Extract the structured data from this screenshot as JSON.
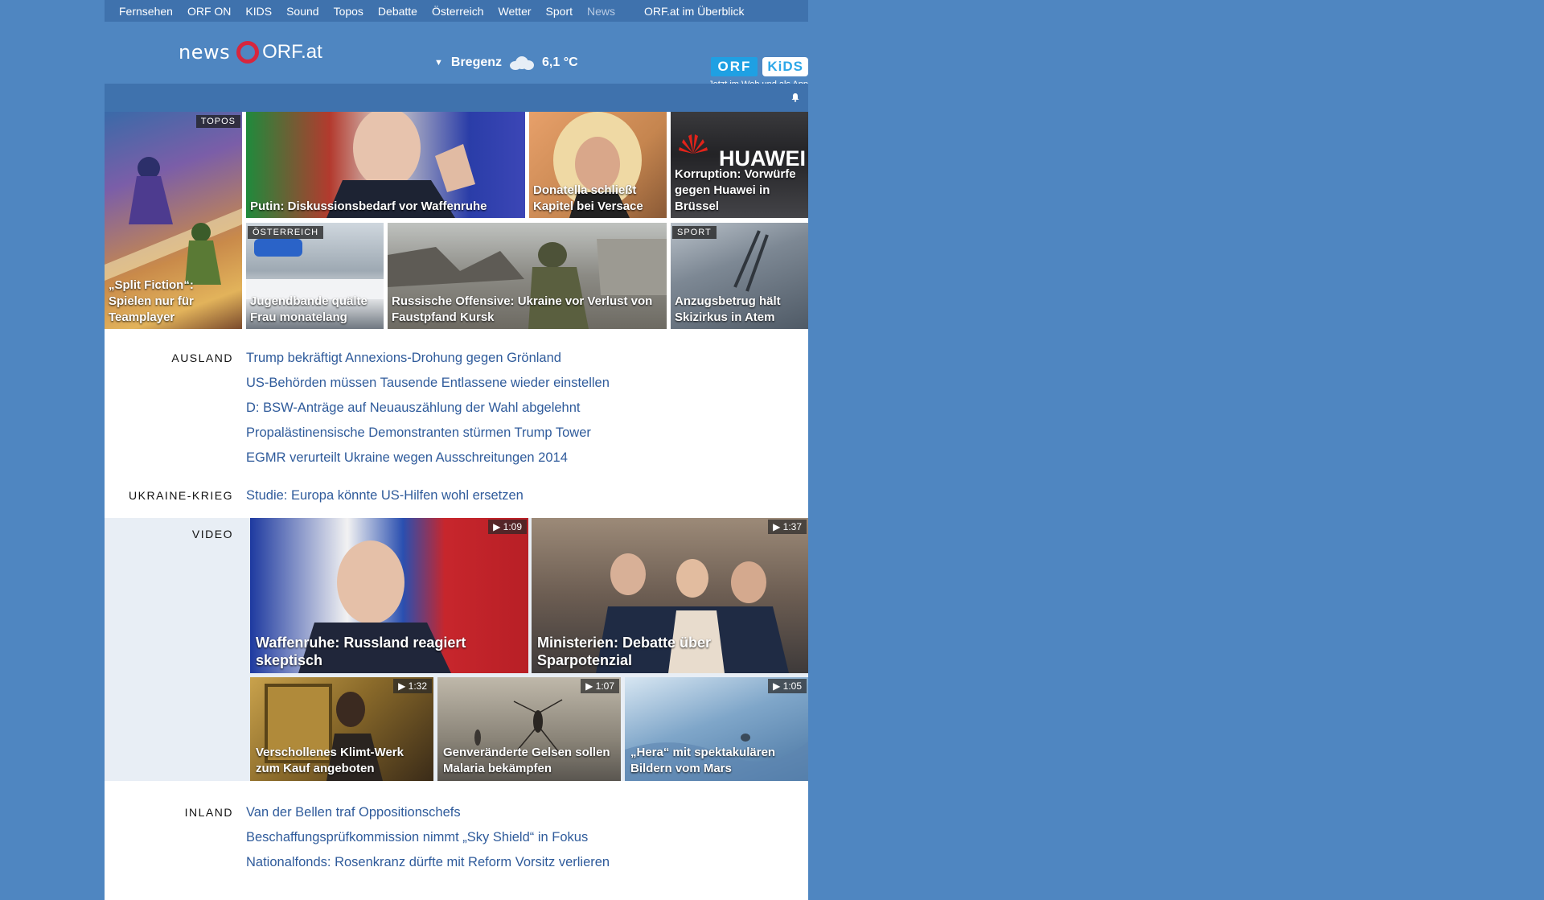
{
  "topnav": {
    "items": [
      "Fernsehen",
      "ORF ON",
      "KIDS",
      "Sound",
      "Topos",
      "Debatte",
      "Österreich",
      "Wetter",
      "Sport",
      "News"
    ],
    "overview": "ORF.at im Überblick"
  },
  "header": {
    "logo_news": "news",
    "logo_orf": "ORF.at",
    "weather_city": "Bregenz",
    "weather_temp": "6,1 °C",
    "kids_orf": "ORF",
    "kids_kids": "KiDS",
    "kids_tagline": "Jetzt im Web und als App"
  },
  "tiles": [
    {
      "caption": "„Split Fiction“: Spielen nur für Teamplayer",
      "badge": "TOPOS"
    },
    {
      "caption": "Putin: Diskussionsbedarf vor Waffenruhe",
      "badge": ""
    },
    {
      "caption": "Donatella schließt Kapitel bei Versace",
      "badge": ""
    },
    {
      "caption": "Korruption: Vorwürfe gegen Huawei in Brüssel",
      "badge": "",
      "brand_text": "HUAWEI"
    },
    {
      "caption": "Jugendbande quälte Frau monatelang",
      "badge": "ÖSTERREICH"
    },
    {
      "caption": "Russische Offensive: Ukraine vor Verlust von Faustpfand Kursk",
      "badge": ""
    },
    {
      "caption": "Anzugsbetrug hält Skizirkus in Atem",
      "badge": "SPORT"
    }
  ],
  "sections": {
    "ausland": {
      "label": "AUSLAND",
      "links": [
        "Trump bekräftigt Annexions-Drohung gegen Grönland",
        "US-Behörden müssen Tausende Entlassene wieder einstellen",
        "D: BSW-Anträge auf Neuauszählung der Wahl abgelehnt",
        "Propalästinensische Demonstranten stürmen Trump Tower",
        "EGMR verurteilt Ukraine wegen Ausschreitungen 2014"
      ]
    },
    "ukraine": {
      "label": "UKRAINE-KRIEG",
      "links": [
        "Studie: Europa könnte US-Hilfen wohl ersetzen"
      ]
    },
    "video": {
      "label": "VIDEO",
      "items": [
        {
          "caption": "Waffenruhe: Russland reagiert skeptisch",
          "duration": "1:09"
        },
        {
          "caption": "Ministerien: Debatte über Sparpotenzial",
          "duration": "1:37"
        },
        {
          "caption": "Verschollenes Klimt-Werk zum Kauf angeboten",
          "duration": "1:32"
        },
        {
          "caption": "Genveränderte Gelsen sollen Malaria bekämpfen",
          "duration": "1:07"
        },
        {
          "caption": "„Hera“ mit spektakulären Bildern vom Mars",
          "duration": "1:05"
        }
      ]
    },
    "inland": {
      "label": "INLAND",
      "links": [
        "Van der Bellen traf Oppositionschefs",
        "Beschaffungsprüfkommission nimmt „Sky Shield“ in Fokus",
        "Nationalfonds: Rosenkranz dürfte mit Reform Vorsitz verlieren"
      ]
    }
  }
}
